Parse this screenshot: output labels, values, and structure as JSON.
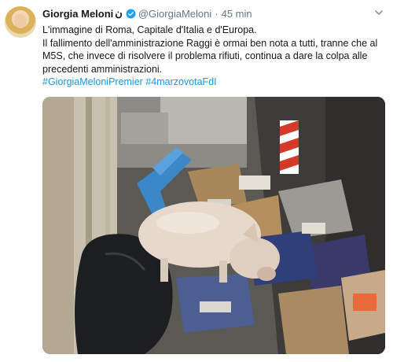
{
  "tweet": {
    "author_name": "Giorgia Meloni",
    "name_suffix": "ن",
    "handle": "@GiorgiaMeloni",
    "separator": "·",
    "time": "45 min",
    "lines": [
      "L'immagine di Roma, Capitale d'Italia e d'Europa.",
      "Il fallimento dell'amministrazione Raggi è ormai ben nota a tutti, tranne che al M5S, che invece di risolvere il problema rifiuti, continua a dare la colpa alle precedenti amministrazioni."
    ],
    "hashtags": "#GiorgiaMeloniPremier #4marzovotaFdI"
  },
  "colors": {
    "link": "#1b95e0",
    "secondary": "#657786",
    "verified": "#1da1f2"
  },
  "icons": {
    "verified": "verified-badge-icon",
    "menu": "chevron-down-icon"
  }
}
